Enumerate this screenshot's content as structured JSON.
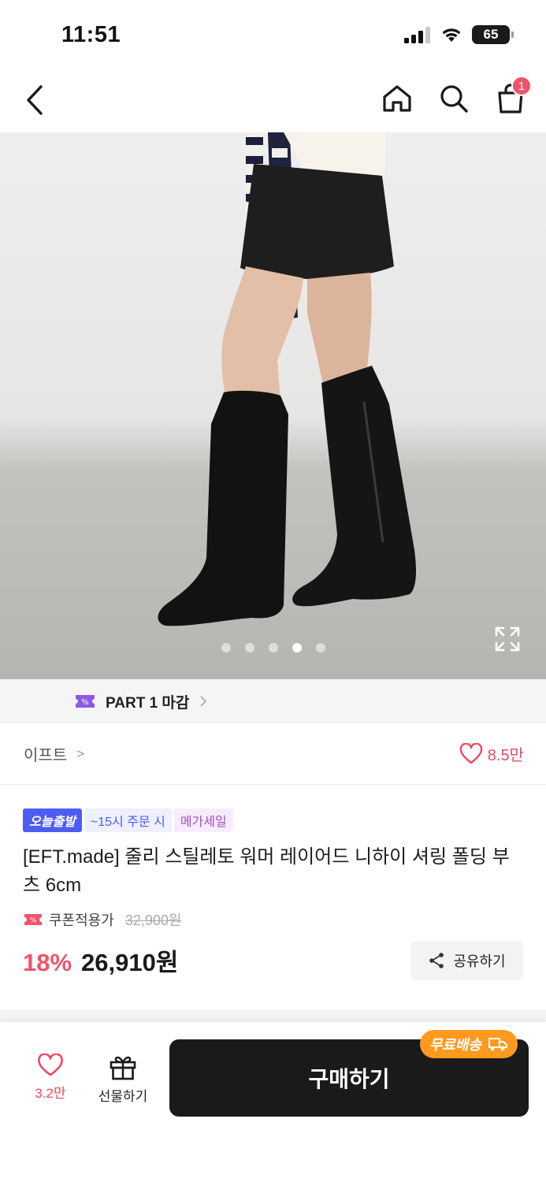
{
  "status_bar": {
    "time": "11:51",
    "battery": "65"
  },
  "nav": {
    "cart_count": "1"
  },
  "gallery": {
    "total_images": 5,
    "active_index": 3
  },
  "promo": {
    "label": "PART 1 마감"
  },
  "brand": {
    "name": "이프트",
    "arrow": ">",
    "likes": "8.5만"
  },
  "product": {
    "badges": {
      "today_ship": "오늘출발",
      "cutoff": "~15시 주문 시",
      "sale": "메가세일"
    },
    "title": "[EFT.made] 줄리 스틸레토 워머 레이어드 니하이 셔링 폴딩 부츠 6cm",
    "coupon_label": "쿠폰적용가",
    "original_price": "32,900원",
    "discount": "18%",
    "price": "26,910원",
    "share_label": "공유하기"
  },
  "bottom_bar": {
    "likes": "3.2만",
    "gift_label": "선물하기",
    "buy_label": "구매하기",
    "free_shipping": "무료배송"
  },
  "colors": {
    "accent_pink": "#f0536a",
    "badge_blue": "#4d5cf2",
    "badge_purple": "#a44fc6",
    "free_ship_orange": "#ff9a1f",
    "buy_button": "#1a1a1a"
  }
}
